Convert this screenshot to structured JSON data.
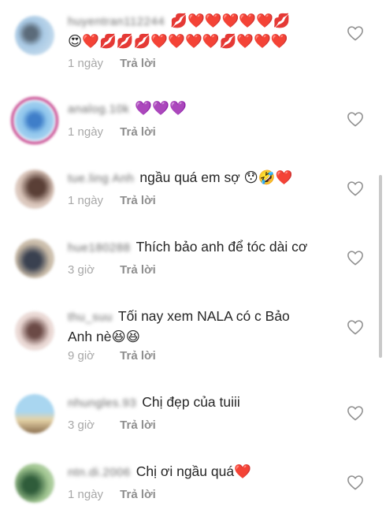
{
  "comments": [
    {
      "username": "huyentran112244",
      "text_line1": "💋❤️❤️❤️❤️❤️💋",
      "text_line2": "😍❤️💋💋💋❤️❤️❤️❤️💋❤️❤️❤️",
      "time": "1 ngày",
      "reply": "Trả lời",
      "avatar_colors": [
        "#a9c9e4",
        "#5b6b7a"
      ]
    },
    {
      "username": "analog.10k",
      "text_line1": "💜💜💜",
      "text_line2": "",
      "time": "1 ngày",
      "reply": "Trả lời",
      "avatar_colors": [
        "#8ec5ec",
        "#3f7ec9"
      ]
    },
    {
      "username": "tue.ling Anh",
      "text_line1": "ngầu quá em sợ 😯🤣❤️",
      "text_line2": "",
      "time": "1 ngày",
      "reply": "Trả lời",
      "avatar_colors": [
        "#d8c3b8",
        "#5a3f36"
      ]
    },
    {
      "username": "hue180288",
      "text_line1": "Thích bảo anh để tóc dài cơ",
      "text_line2": "",
      "time": "3 giờ",
      "reply": "Trả lời",
      "avatar_colors": [
        "#c7b9a6",
        "#3a4150"
      ]
    },
    {
      "username": "thu_suu",
      "text_line1": "Tối nay xem NALA có c Bảo",
      "text_line2": "Anh nè😆😆",
      "time": "9 giờ",
      "reply": "Trả lời",
      "avatar_colors": [
        "#e9d7d3",
        "#6b4a46"
      ]
    },
    {
      "username": "nhungles.93",
      "text_line1": "Chị đẹp của tuiii",
      "text_line2": "",
      "time": "3 giờ",
      "reply": "Trả lời",
      "avatar_colors": [
        "#a9d6f0",
        "#e6d3a7"
      ]
    },
    {
      "username": "ntn.di.2006",
      "text_line1": "Chị ơi ngầu quá❤️",
      "text_line2": "",
      "time": "1 ngày",
      "reply": "Trả lời",
      "avatar_colors": [
        "#9fc48f",
        "#2f5c3a"
      ]
    }
  ],
  "icons": {
    "like": "heart-outline-icon"
  }
}
